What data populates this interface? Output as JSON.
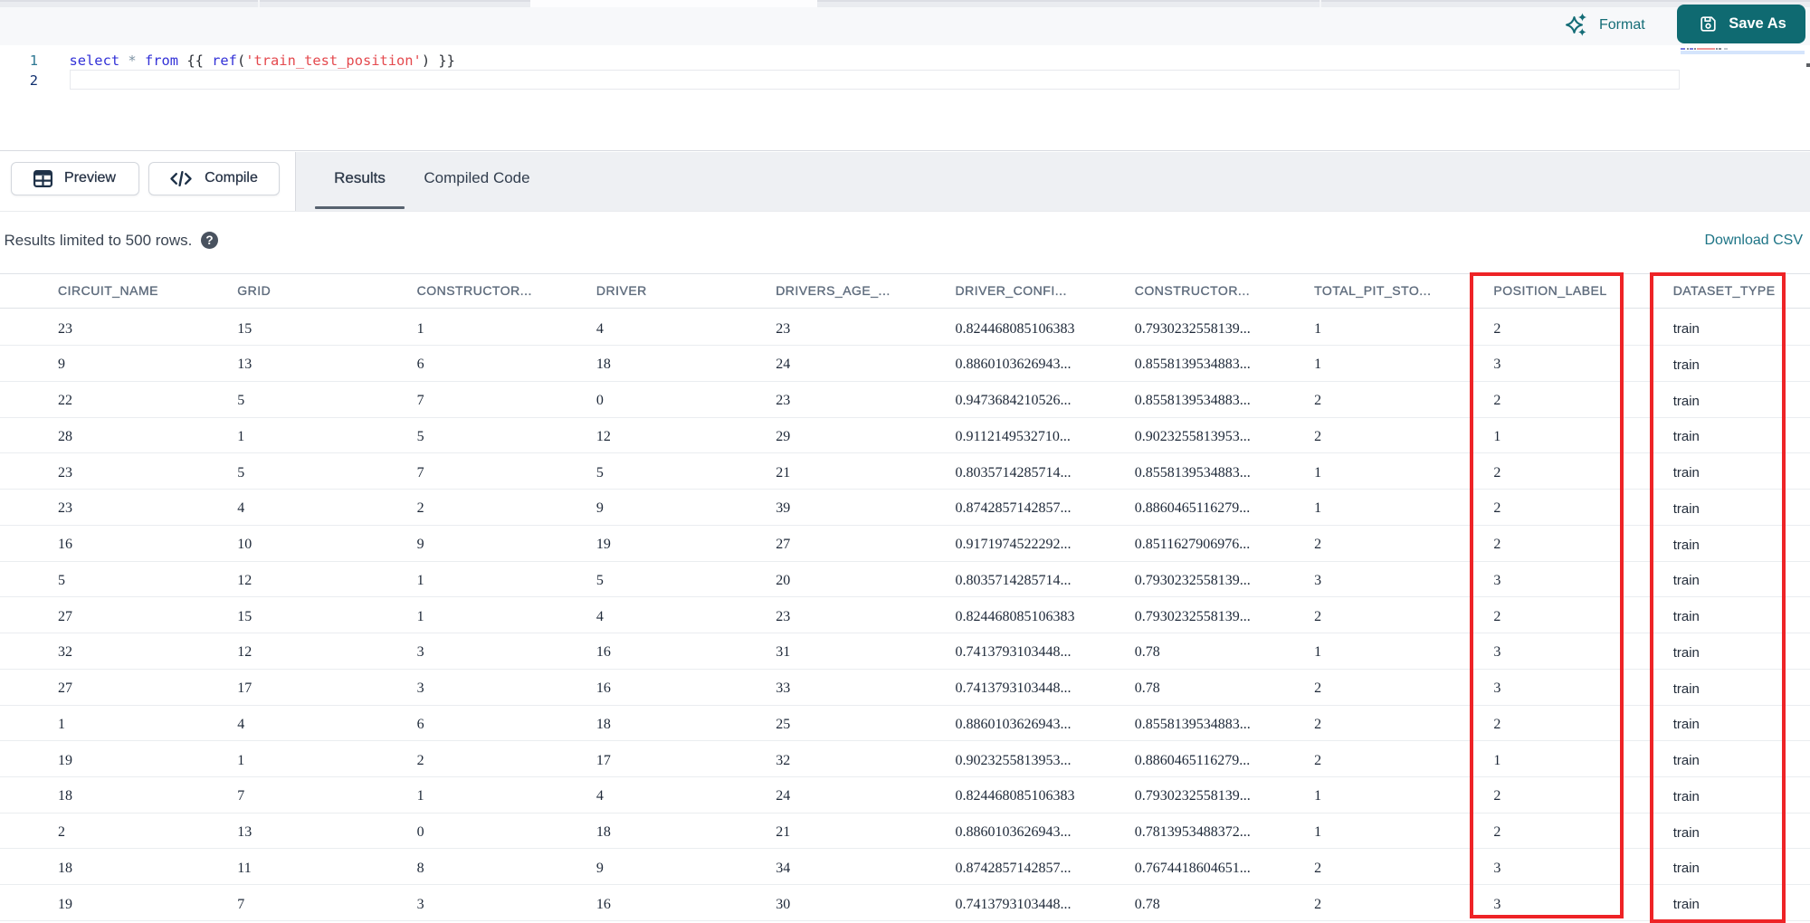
{
  "toolbar": {
    "format_label": "Format",
    "save_as_label": "Save As"
  },
  "editor": {
    "line_numbers": [
      "1",
      "2"
    ],
    "code_tokens": [
      {
        "text": "select",
        "type": "keyword"
      },
      {
        "text": " ",
        "type": "plain"
      },
      {
        "text": "*",
        "type": "operator"
      },
      {
        "text": " ",
        "type": "plain"
      },
      {
        "text": "from",
        "type": "keyword"
      },
      {
        "text": " ",
        "type": "plain"
      },
      {
        "text": "{{",
        "type": "brace"
      },
      {
        "text": " ",
        "type": "plain"
      },
      {
        "text": "ref",
        "type": "function"
      },
      {
        "text": "(",
        "type": "brace"
      },
      {
        "text": "'train_test_position'",
        "type": "string"
      },
      {
        "text": ")",
        "type": "brace"
      },
      {
        "text": " ",
        "type": "plain"
      },
      {
        "text": "}}",
        "type": "brace"
      }
    ]
  },
  "actions": {
    "preview_label": "Preview",
    "compile_label": "Compile"
  },
  "tabs": {
    "results": "Results",
    "compiled_code": "Compiled Code"
  },
  "results_bar": {
    "note": "Results limited to 500 rows.",
    "download_csv": "Download CSV"
  },
  "table": {
    "columns": [
      "CIRCUIT_NAME",
      "GRID",
      "CONSTRUCTOR...",
      "DRIVER",
      "DRIVERS_AGE_...",
      "DRIVER_CONFI...",
      "CONSTRUCTOR...",
      "TOTAL_PIT_STO...",
      "POSITION_LABEL",
      "DATASET_TYPE"
    ],
    "rows": [
      [
        "23",
        "15",
        "1",
        "4",
        "23",
        "0.824468085106383",
        "0.7930232558139...",
        "1",
        "2",
        "train"
      ],
      [
        "9",
        "13",
        "6",
        "18",
        "24",
        "0.8860103626943...",
        "0.8558139534883...",
        "1",
        "3",
        "train"
      ],
      [
        "22",
        "5",
        "7",
        "0",
        "23",
        "0.9473684210526...",
        "0.8558139534883...",
        "2",
        "2",
        "train"
      ],
      [
        "28",
        "1",
        "5",
        "12",
        "29",
        "0.9112149532710...",
        "0.9023255813953...",
        "2",
        "1",
        "train"
      ],
      [
        "23",
        "5",
        "7",
        "5",
        "21",
        "0.8035714285714...",
        "0.8558139534883...",
        "1",
        "2",
        "train"
      ],
      [
        "23",
        "4",
        "2",
        "9",
        "39",
        "0.8742857142857...",
        "0.8860465116279...",
        "1",
        "2",
        "train"
      ],
      [
        "16",
        "10",
        "9",
        "19",
        "27",
        "0.9171974522292...",
        "0.8511627906976...",
        "2",
        "2",
        "train"
      ],
      [
        "5",
        "12",
        "1",
        "5",
        "20",
        "0.8035714285714...",
        "0.7930232558139...",
        "3",
        "3",
        "train"
      ],
      [
        "27",
        "15",
        "1",
        "4",
        "23",
        "0.824468085106383",
        "0.7930232558139...",
        "2",
        "2",
        "train"
      ],
      [
        "32",
        "12",
        "3",
        "16",
        "31",
        "0.7413793103448...",
        "0.78",
        "1",
        "3",
        "train"
      ],
      [
        "27",
        "17",
        "3",
        "16",
        "33",
        "0.7413793103448...",
        "0.78",
        "2",
        "3",
        "train"
      ],
      [
        "1",
        "4",
        "6",
        "18",
        "25",
        "0.8860103626943...",
        "0.8558139534883...",
        "2",
        "2",
        "train"
      ],
      [
        "19",
        "1",
        "2",
        "17",
        "32",
        "0.9023255813953...",
        "0.8860465116279...",
        "2",
        "1",
        "train"
      ],
      [
        "18",
        "7",
        "1",
        "4",
        "24",
        "0.824468085106383",
        "0.7930232558139...",
        "1",
        "2",
        "train"
      ],
      [
        "2",
        "13",
        "0",
        "18",
        "21",
        "0.8860103626943...",
        "0.7813953488372...",
        "1",
        "2",
        "train"
      ],
      [
        "18",
        "11",
        "8",
        "9",
        "34",
        "0.8742857142857...",
        "0.7674418604651...",
        "2",
        "3",
        "train"
      ],
      [
        "19",
        "7",
        "3",
        "16",
        "30",
        "0.7413793103448...",
        "0.78",
        "2",
        "3",
        "train"
      ]
    ]
  },
  "annotations": {
    "highlight_color": "#ee2326",
    "boxes": [
      "POSITION_LABEL column",
      "DATASET_TYPE column"
    ]
  },
  "colors": {
    "accent_teal": "#0f6a71",
    "link_teal": "#1d7486",
    "panel_gray": "#eef0f3",
    "keyword_blue": "#3231d7",
    "string_red": "#e4494e"
  }
}
